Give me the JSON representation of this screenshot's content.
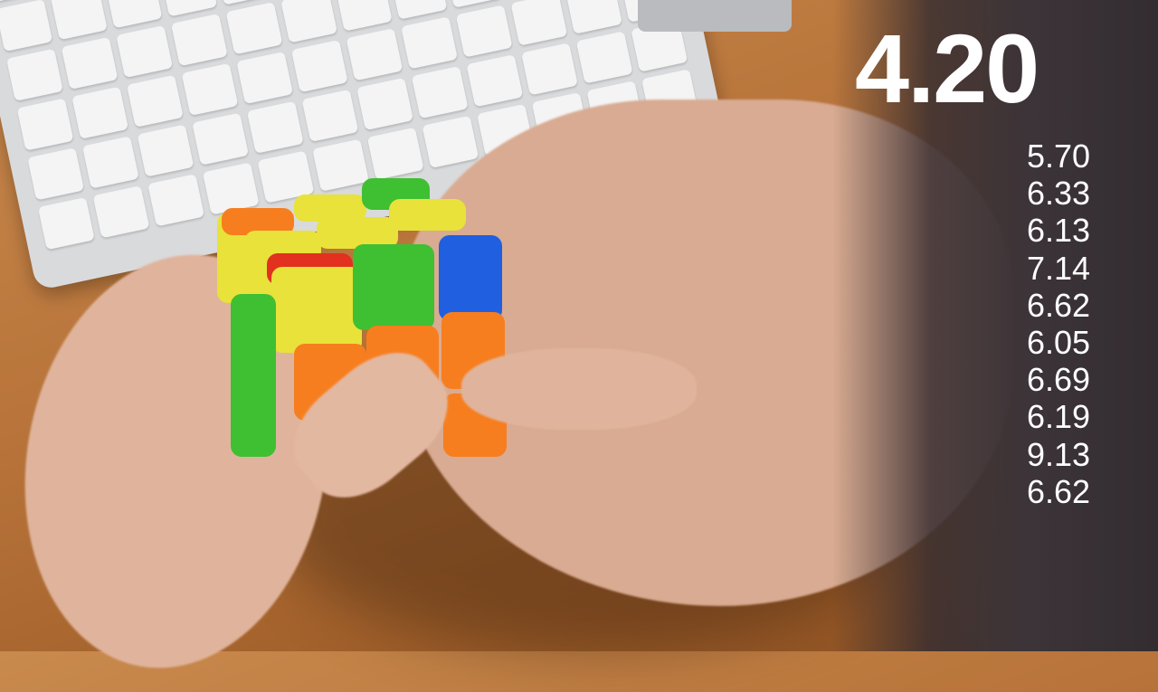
{
  "timer": {
    "current": "4.20"
  },
  "previous_times": [
    "5.70",
    "6.33",
    "6.13",
    "7.14",
    "6.62",
    "6.05",
    "6.69",
    "6.19",
    "9.13",
    "6.62"
  ],
  "colors": {
    "wood": "#b8743a",
    "cube_yellow": "#e8e23a",
    "cube_green": "#3fbf32",
    "cube_orange": "#f77e1e",
    "cube_blue": "#1f5fe0",
    "cube_red": "#e2311f"
  }
}
